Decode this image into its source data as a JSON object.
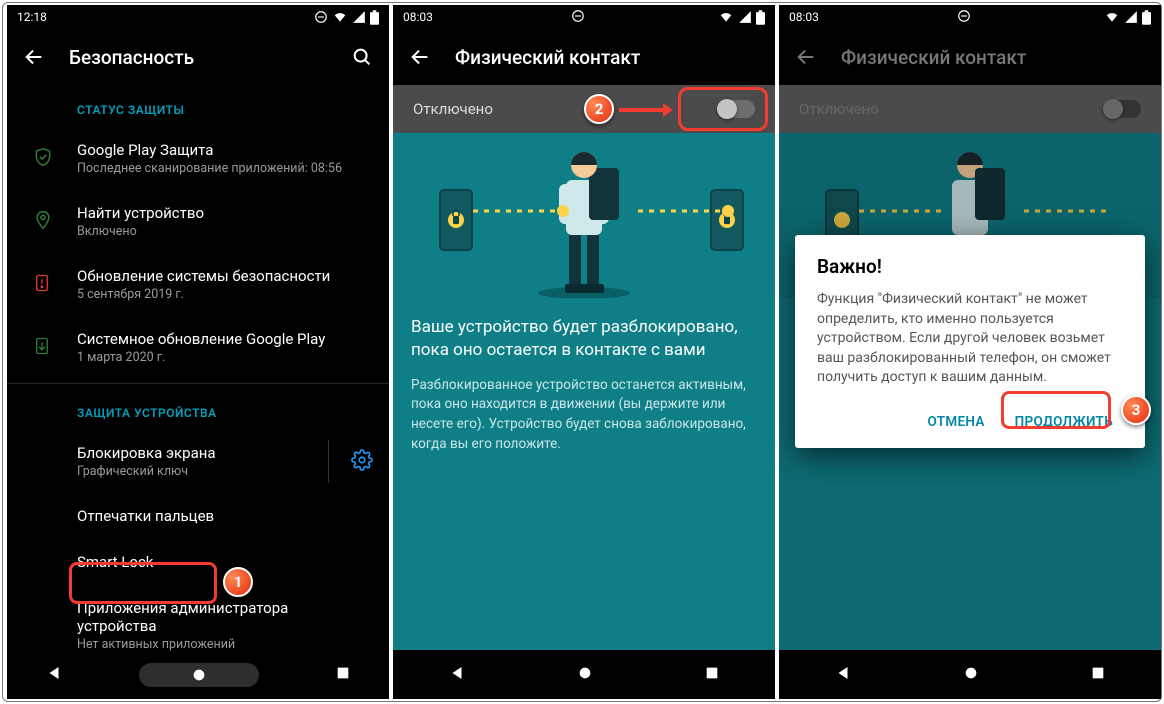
{
  "markers": {
    "m1": "1",
    "m2": "2",
    "m3": "3"
  },
  "panel1": {
    "status_time": "12:18",
    "title": "Безопасность",
    "section_status": "СТАТУС ЗАЩИТЫ",
    "play_protect": {
      "title": "Google Play Защита",
      "sub": "Последнее сканирование приложений: 08:56"
    },
    "find_device": {
      "title": "Найти устройство",
      "sub": "Включено"
    },
    "security_update": {
      "title": "Обновление системы безопасности",
      "sub": "5 сентября 2019 г."
    },
    "play_system_update": {
      "title": "Системное обновление Google Play",
      "sub": "1 марта 2020 г."
    },
    "section_device": "ЗАЩИТА УСТРОЙСТВА",
    "screen_lock": {
      "title": "Блокировка экрана",
      "sub": "Графический ключ"
    },
    "fingerprints": "Отпечатки пальцев",
    "smart_lock": "Smart Lock",
    "device_admin": {
      "title": "Приложения администратора устройства",
      "sub": "Нет активных приложений"
    }
  },
  "panel2": {
    "status_time": "08:03",
    "title": "Физический контакт",
    "toggle_label": "Отключено",
    "heading": "Ваше устройство будет разблокировано, пока оно остается в контакте с вами",
    "body": "Разблокированное устройство останется активным, пока оно находится в движении (вы держите или несете его). Устройство будет снова заблокировано, когда вы его положите."
  },
  "panel3": {
    "status_time": "08:03",
    "title": "Физический контакт",
    "toggle_label": "Отключено",
    "dialog": {
      "title": "Важно!",
      "body": "Функция \"Физический контакт\" не может определить, кто именно пользуется устройством. Если другой человек возьмет ваш разблокированный телефон, он сможет получить доступ к вашим данным.",
      "cancel": "ОТМЕНА",
      "continue": "ПРОДОЛЖИТЬ"
    }
  }
}
